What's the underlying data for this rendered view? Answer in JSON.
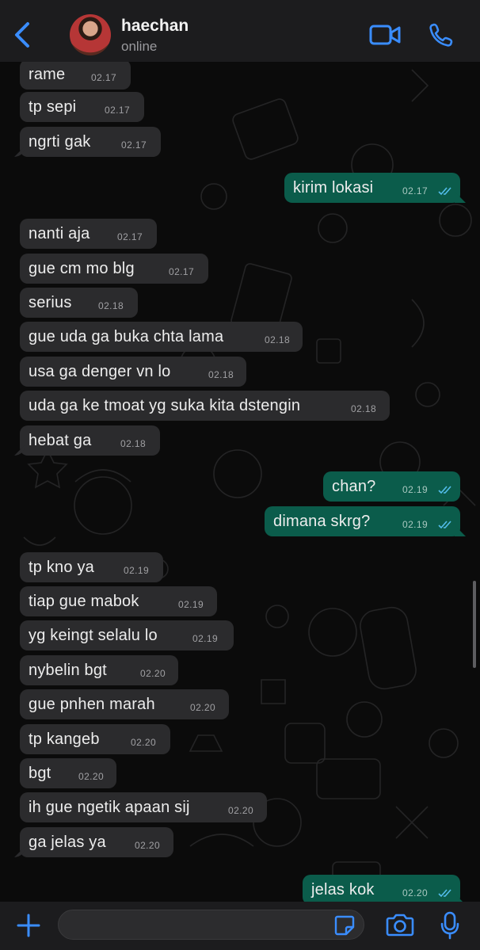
{
  "header": {
    "contact_name": "haechan",
    "status": "online",
    "icons": {
      "back": "chevron-left-icon",
      "video": "video-camera-icon",
      "call": "phone-icon"
    },
    "accent_color": "#3a8dff"
  },
  "messages": [
    {
      "text": "rame",
      "time": "02.17",
      "dir": "in"
    },
    {
      "text": "tp sepi",
      "time": "02.17",
      "dir": "in"
    },
    {
      "text": "ngrti gak",
      "time": "02.17",
      "dir": "in"
    },
    {
      "text": "kirim lokasi",
      "time": "02.17",
      "dir": "out",
      "read": true
    },
    {
      "text": "nanti aja",
      "time": "02.17",
      "dir": "in"
    },
    {
      "text": "gue cm mo blg",
      "time": "02.17",
      "dir": "in"
    },
    {
      "text": "serius",
      "time": "02.18",
      "dir": "in"
    },
    {
      "text": "gue uda ga buka chta lama",
      "time": "02.18",
      "dir": "in"
    },
    {
      "text": "usa ga denger vn lo",
      "time": "02.18",
      "dir": "in"
    },
    {
      "text": "uda ga ke tmoat yg suka kita dstengin",
      "time": "02.18",
      "dir": "in"
    },
    {
      "text": "hebat ga",
      "time": "02.18",
      "dir": "in"
    },
    {
      "text": "chan?",
      "time": "02.19",
      "dir": "out",
      "read": true
    },
    {
      "text": "dimana skrg?",
      "time": "02.19",
      "dir": "out",
      "read": true
    },
    {
      "text": "tp kno ya",
      "time": "02.19",
      "dir": "in"
    },
    {
      "text": "tiap gue mabok",
      "time": "02.19",
      "dir": "in"
    },
    {
      "text": "yg keingt selalu lo",
      "time": "02.19",
      "dir": "in"
    },
    {
      "text": "nybelin bgt",
      "time": "02.20",
      "dir": "in"
    },
    {
      "text": "gue pnhen marah",
      "time": "02.20",
      "dir": "in"
    },
    {
      "text": "tp kangeb",
      "time": "02.20",
      "dir": "in"
    },
    {
      "text": "bgt",
      "time": "02.20",
      "dir": "in"
    },
    {
      "text": "ih gue ngetik apaan sij",
      "time": "02.20",
      "dir": "in"
    },
    {
      "text": "ga jelas ya",
      "time": "02.20",
      "dir": "in"
    },
    {
      "text": "jelas kok",
      "time": "02.20",
      "dir": "out",
      "read": true
    }
  ],
  "colors": {
    "incoming_bubble": "#2b2b2d",
    "outgoing_bubble": "#0b5c4b",
    "read_ticks": "#53bdeb"
  },
  "footer": {
    "icons": {
      "attach": "plus-icon",
      "sticker": "sticker-icon",
      "camera": "camera-icon",
      "mic": "microphone-icon"
    }
  }
}
